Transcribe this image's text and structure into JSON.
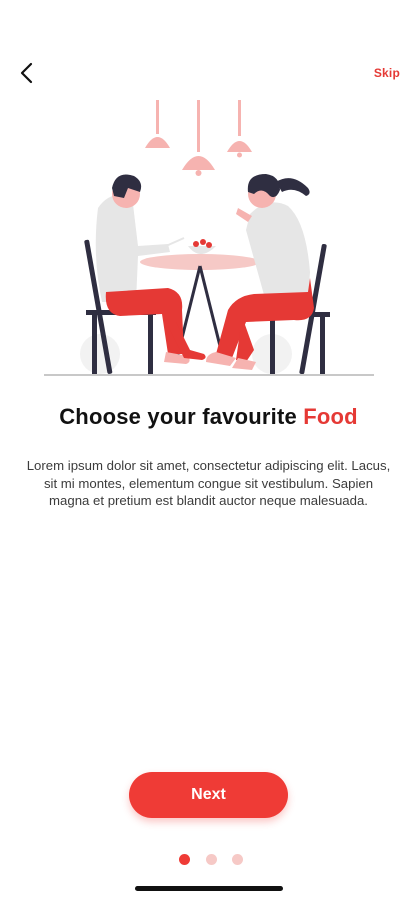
{
  "header": {
    "back_icon": "chevron-left-icon",
    "skip_label": "Skip"
  },
  "illustration": {
    "description_icon": "couple-dining-illustration",
    "colors": {
      "accent_red": "#e53935",
      "lamp_pink": "#f6b3b0",
      "shirt_gray": "#e6e6e6",
      "chair_navy": "#2f2e41",
      "hair_dark": "#2f2e41"
    }
  },
  "content": {
    "title_prefix": "Choose your favourite ",
    "title_accent": "Food",
    "description": "Lorem ipsum dolor sit amet, consectetur adipiscing elit. Lacus, sit mi montes, elementum congue sit vestibulum. Sapien magna et pretium est blandit auctor neque malesuada."
  },
  "actions": {
    "next_label": "Next"
  },
  "pager": {
    "total": 3,
    "active_index": 0
  },
  "theme": {
    "primary": "#ef3b36",
    "dot_inactive": "#f6c9c6",
    "text_dark": "#111111",
    "text_body": "#3c3c3c"
  }
}
